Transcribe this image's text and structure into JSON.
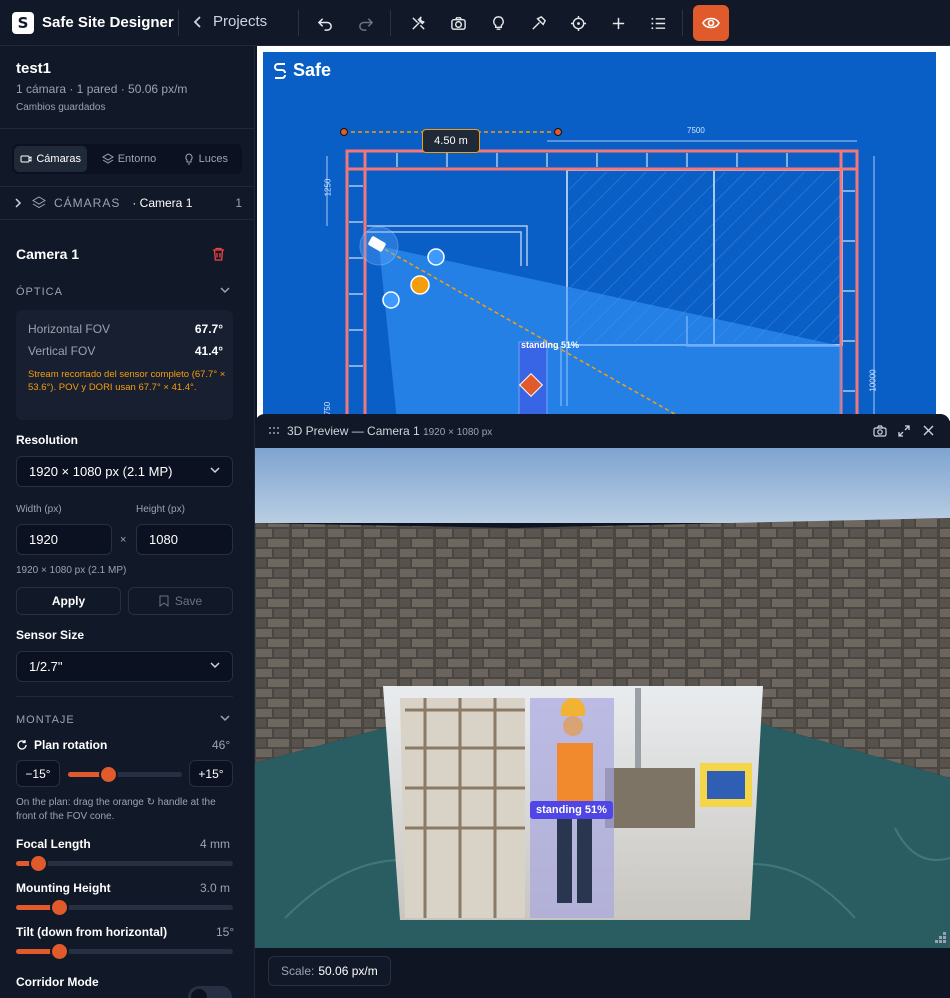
{
  "app": {
    "name": "Safe Site Designer",
    "projects_label": "Projects"
  },
  "project": {
    "title": "test1",
    "summary": "1 cámara · 1 pared · 50.06 px/m",
    "status": "Cambios guardados"
  },
  "tabs": [
    {
      "label": "Cámaras",
      "icon": "camera-icon"
    },
    {
      "label": "Entorno",
      "icon": "layers-icon"
    },
    {
      "label": "Luces",
      "icon": "bulb-icon"
    }
  ],
  "cameras_section": {
    "title": "CÁMARAS",
    "current": "· Camera 1",
    "count": "1"
  },
  "camera": {
    "name": "Camera 1"
  },
  "optics": {
    "title": "ÓPTICA",
    "hfov_label": "Horizontal FOV",
    "hfov": "67.7°",
    "vfov_label": "Vertical FOV",
    "vfov": "41.4°",
    "warning": "Stream recortado del sensor completo (67.7° × 53.6°). POV y DORI usan 67.7° × 41.4°."
  },
  "resolution": {
    "label": "Resolution",
    "selected": "1920 × 1080 px (2.1 MP)",
    "width_label": "Width (px)",
    "height_label": "Height (px)",
    "width": "1920",
    "height": "1080",
    "times": "×",
    "summary": "1920 × 1080 px (2.1 MP)",
    "apply": "Apply",
    "save": "Save"
  },
  "sensor": {
    "label": "Sensor Size",
    "selected": "1/2.7\""
  },
  "mounting": {
    "title": "MONTAJE",
    "rotation_label": "Plan rotation",
    "rotation_value": "46°",
    "rotation_fraction": 0.35,
    "minus": "−15°",
    "plus": "+15°",
    "hint": "On the plan: drag the orange ↻ handle at the front of the FOV cone.",
    "focal_label": "Focal Length",
    "focal_value": "4 mm",
    "focal_fraction": 0.1,
    "height_label": "Mounting Height",
    "height_value": "3.0 m",
    "height_fraction": 0.2,
    "tilt_label": "Tilt (down from horizontal)",
    "tilt_value": "15°",
    "tilt_fraction": 0.2,
    "corridor_label": "Corridor Mode"
  },
  "plan": {
    "brand": "Safe",
    "measure": "4.50 m",
    "dim_top": "7500",
    "dim_left": "1250",
    "dim_right": "10000",
    "dim_left2": "750",
    "detection": "standing 51%"
  },
  "preview": {
    "title": "3D Preview — Camera 1",
    "resolution": "1920 × 1080 px",
    "detection": "standing 51%"
  },
  "footer": {
    "scale_label": "Scale:",
    "scale_value": "50.06 px/m"
  },
  "colors": {
    "accent": "#e05a2b",
    "plan_blue": "#0a5fc7",
    "wall_red": "#f2777a",
    "detection": "#4f46e5"
  }
}
